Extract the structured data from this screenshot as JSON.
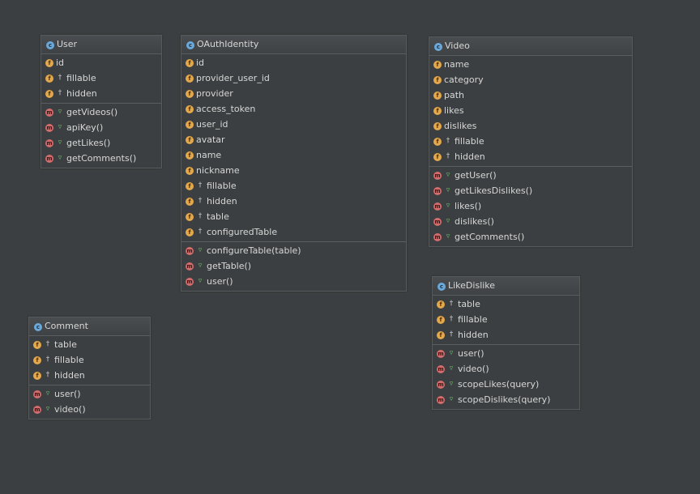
{
  "classes": [
    {
      "name": "User",
      "fields": [
        {
          "icon": "field-icon",
          "vis": "",
          "label": "id"
        },
        {
          "icon": "field-icon",
          "vis": "protected",
          "label": "fillable"
        },
        {
          "icon": "field-icon",
          "vis": "protected",
          "label": "hidden"
        }
      ],
      "methods": [
        {
          "icon": "method-icon",
          "vis": "public",
          "label": "getVideos()"
        },
        {
          "icon": "method-icon",
          "vis": "public",
          "label": "apiKey()"
        },
        {
          "icon": "method-icon",
          "vis": "public",
          "label": "getLikes()"
        },
        {
          "icon": "method-icon",
          "vis": "public",
          "label": "getComments()"
        }
      ]
    },
    {
      "name": "OAuthIdentity",
      "fields": [
        {
          "icon": "field-icon",
          "vis": "",
          "label": "id"
        },
        {
          "icon": "field-icon",
          "vis": "",
          "label": "provider_user_id"
        },
        {
          "icon": "field-icon",
          "vis": "",
          "label": "provider"
        },
        {
          "icon": "field-icon",
          "vis": "",
          "label": "access_token"
        },
        {
          "icon": "field-icon",
          "vis": "",
          "label": "user_id"
        },
        {
          "icon": "field-icon",
          "vis": "",
          "label": "avatar"
        },
        {
          "icon": "field-icon",
          "vis": "",
          "label": "name"
        },
        {
          "icon": "field-icon",
          "vis": "",
          "label": "nickname"
        },
        {
          "icon": "field-icon",
          "vis": "protected",
          "label": "fillable"
        },
        {
          "icon": "field-icon",
          "vis": "protected",
          "label": "hidden"
        },
        {
          "icon": "field-icon",
          "vis": "protected",
          "label": "table"
        },
        {
          "icon": "field-icon",
          "vis": "protected",
          "label": "configuredTable"
        }
      ],
      "methods": [
        {
          "icon": "method-icon",
          "vis": "public",
          "label": "configureTable(table)"
        },
        {
          "icon": "method-icon",
          "vis": "public",
          "label": "getTable()"
        },
        {
          "icon": "method-icon",
          "vis": "public",
          "label": "user()"
        }
      ]
    },
    {
      "name": "Video",
      "fields": [
        {
          "icon": "field-icon",
          "vis": "",
          "label": "name"
        },
        {
          "icon": "field-icon",
          "vis": "",
          "label": "category"
        },
        {
          "icon": "field-icon",
          "vis": "",
          "label": "path"
        },
        {
          "icon": "field-icon",
          "vis": "",
          "label": "likes"
        },
        {
          "icon": "field-icon",
          "vis": "",
          "label": "dislikes"
        },
        {
          "icon": "field-icon",
          "vis": "protected",
          "label": "fillable"
        },
        {
          "icon": "field-icon",
          "vis": "protected",
          "label": "hidden"
        }
      ],
      "methods": [
        {
          "icon": "method-icon",
          "vis": "public",
          "label": "getUser()"
        },
        {
          "icon": "method-icon",
          "vis": "public",
          "label": "getLikesDislikes()"
        },
        {
          "icon": "method-icon",
          "vis": "public",
          "label": "likes()"
        },
        {
          "icon": "method-icon",
          "vis": "public",
          "label": "dislikes()"
        },
        {
          "icon": "method-icon",
          "vis": "public",
          "label": "getComments()"
        }
      ]
    },
    {
      "name": "LikeDislike",
      "fields": [
        {
          "icon": "field-icon",
          "vis": "protected",
          "label": "table"
        },
        {
          "icon": "field-icon",
          "vis": "protected",
          "label": "fillable"
        },
        {
          "icon": "field-icon",
          "vis": "protected",
          "label": "hidden"
        }
      ],
      "methods": [
        {
          "icon": "method-icon",
          "vis": "public",
          "label": "user()"
        },
        {
          "icon": "method-icon",
          "vis": "public",
          "label": "video()"
        },
        {
          "icon": "method-icon",
          "vis": "public",
          "label": "scopeLikes(query)"
        },
        {
          "icon": "method-icon",
          "vis": "public",
          "label": "scopeDislikes(query)"
        }
      ]
    },
    {
      "name": "Comment",
      "fields": [
        {
          "icon": "field-icon",
          "vis": "protected",
          "label": "table"
        },
        {
          "icon": "field-icon",
          "vis": "protected",
          "label": "fillable"
        },
        {
          "icon": "field-icon",
          "vis": "protected",
          "label": "hidden"
        }
      ],
      "methods": [
        {
          "icon": "method-icon",
          "vis": "public",
          "label": "user()"
        },
        {
          "icon": "method-icon",
          "vis": "public",
          "label": "video()"
        }
      ]
    }
  ],
  "colors": {
    "background": "#3c3f41",
    "class_icon": "#6aa9da",
    "field_icon": "#e4a84c",
    "method_icon": "#d36c6c",
    "public_marker": "#6fbf6f"
  }
}
